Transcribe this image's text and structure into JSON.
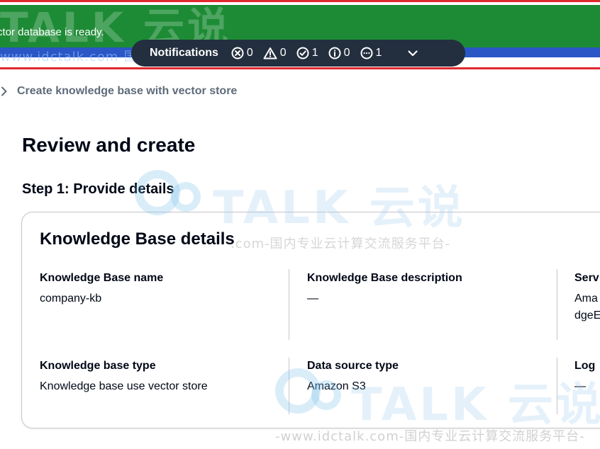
{
  "flash": {
    "message": "ctor database is ready."
  },
  "notifications": {
    "title": "Notifications",
    "counts": {
      "error": "0",
      "warning": "0",
      "success": "1",
      "info": "0",
      "in_progress": "1"
    },
    "icons": [
      "error-icon",
      "warning-icon",
      "success-icon",
      "info-icon",
      "in-progress-icon",
      "chevron-down-icon"
    ]
  },
  "breadcrumb": {
    "label": "Create knowledge base with vector store"
  },
  "page": {
    "title": "Review and create",
    "step_title": "Step 1: Provide details"
  },
  "details": {
    "title": "Knowledge Base details",
    "name_label": "Knowledge Base name",
    "name_value": "company-kb",
    "description_label": "Knowledge Base description",
    "description_value": "—",
    "service_label": "Serv",
    "service_value_line1": "Ama",
    "service_value_line2": "dgeE",
    "type_label": "Knowledge base type",
    "type_value": "Knowledge base use vector store",
    "datasource_label": "Data source type",
    "datasource_value": "Amazon S3",
    "log_label": "Log",
    "log_value": "—"
  },
  "watermark": {
    "brand": "TALK 云说",
    "url_line": "-www.idctalk.com-国内专业云计算交流服务平台-",
    "url_line_short": "www.idctalk.com-国内专业云计算交流服务平台",
    "mid_line": ".com-国内专业云计算交流服务平台-"
  },
  "colors": {
    "flash_green": "#1d8b35",
    "notif_bg": "#232f3e",
    "text": "#000716",
    "muted": "#5f6b7a",
    "border": "#c6c6cd",
    "red": "#e0282e",
    "blue": "#2a56c6"
  }
}
